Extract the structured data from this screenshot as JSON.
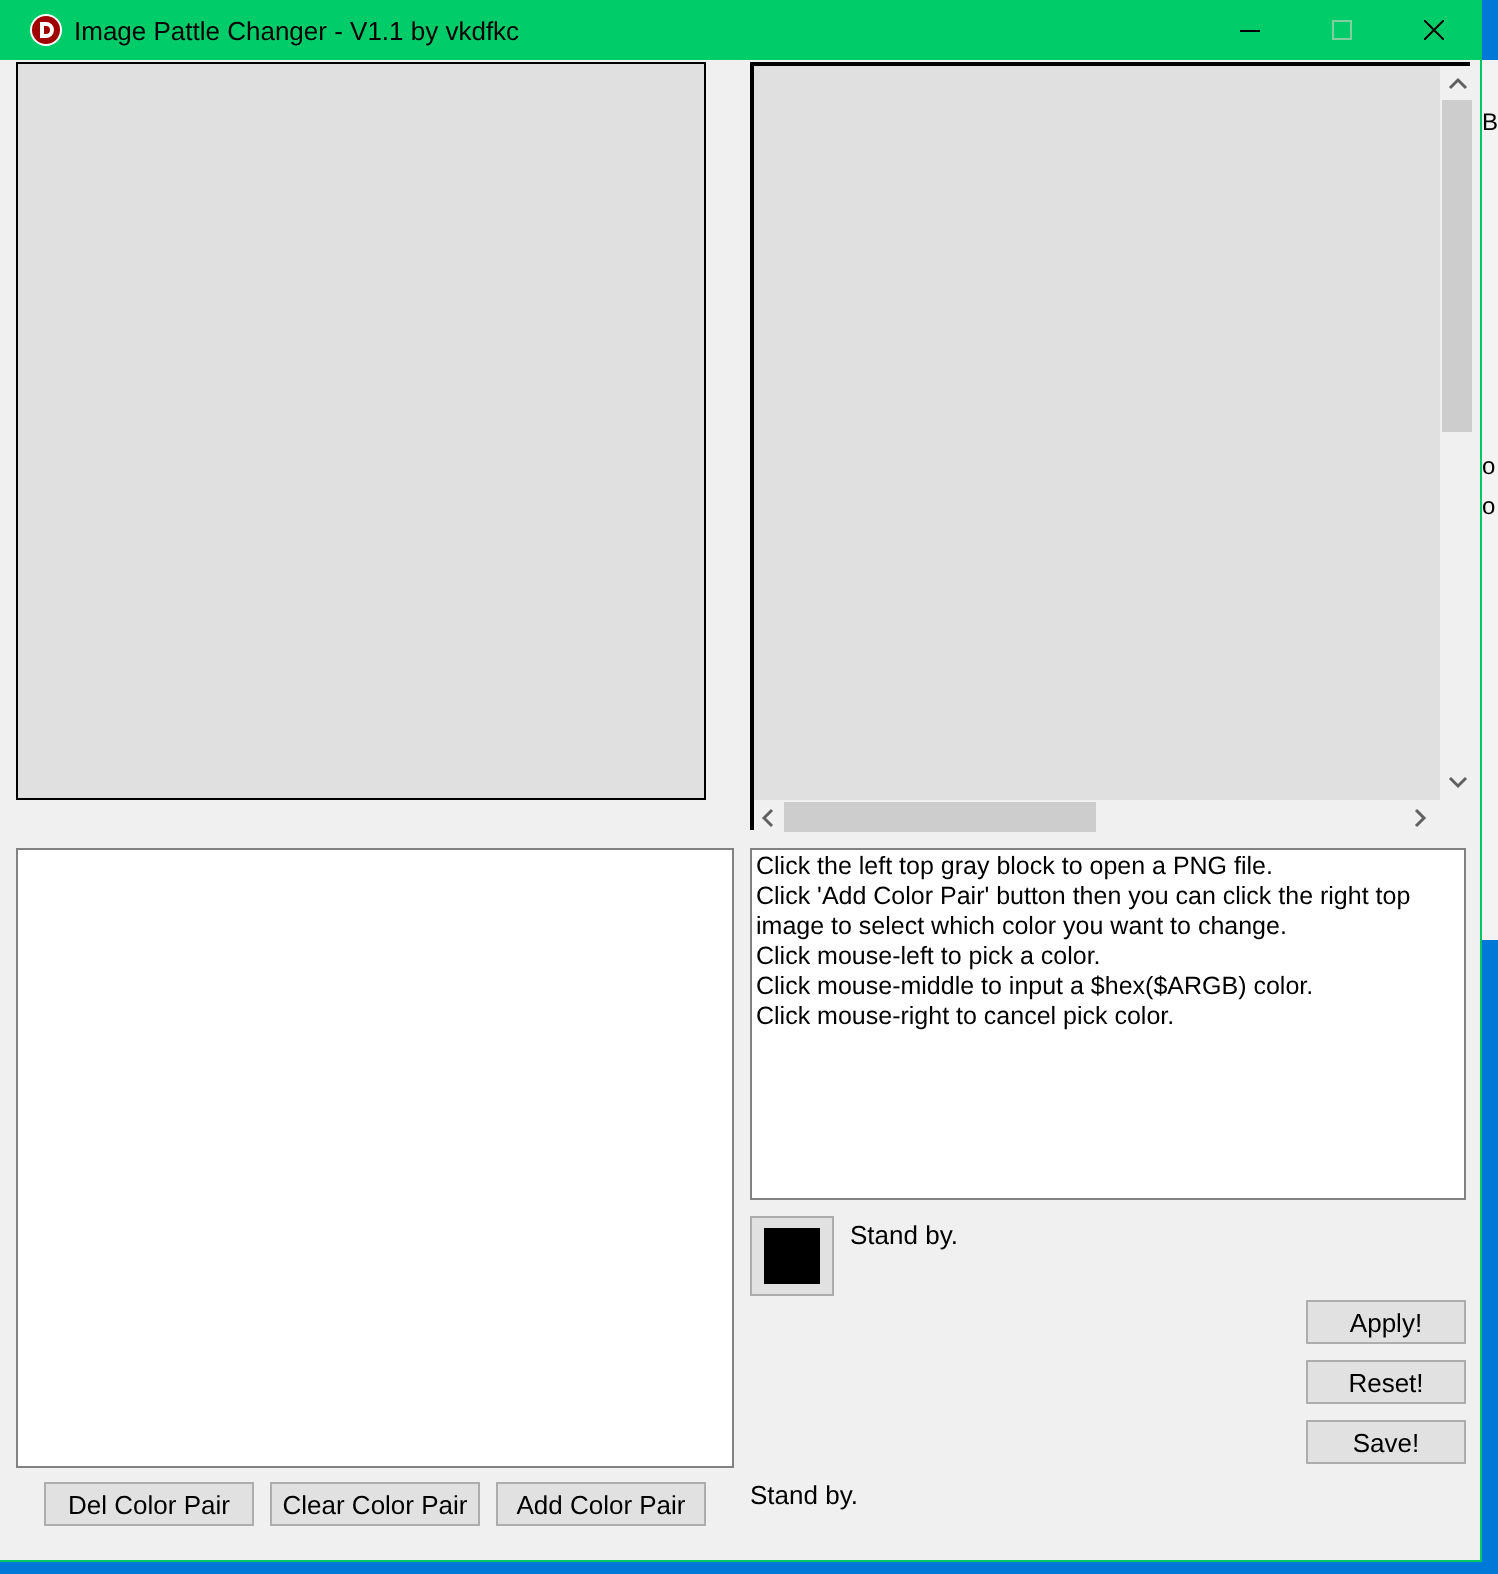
{
  "background_window": {
    "texts": [
      "B",
      "o",
      "o"
    ]
  },
  "window": {
    "title": "Image Pattle Changer - V1.1 by vkdfkc"
  },
  "help_text": [
    "Click the left top gray block to open a PNG file.",
    "Click 'Add Color Pair' button then you can click the right top image to select which color you want to change.",
    "Click mouse-left to pick a color.",
    "Click mouse-middle to input a $hex($ARGB) color.",
    "Click mouse-right to cancel pick color."
  ],
  "picked_color": {
    "color": "#000000",
    "status": "Stand by."
  },
  "action_buttons": [
    "Apply!",
    "Reset!",
    "Save!"
  ],
  "pair_buttons": [
    "Del Color Pair",
    "Clear Color Pair",
    "Add Color Pair"
  ],
  "status": "Stand by."
}
